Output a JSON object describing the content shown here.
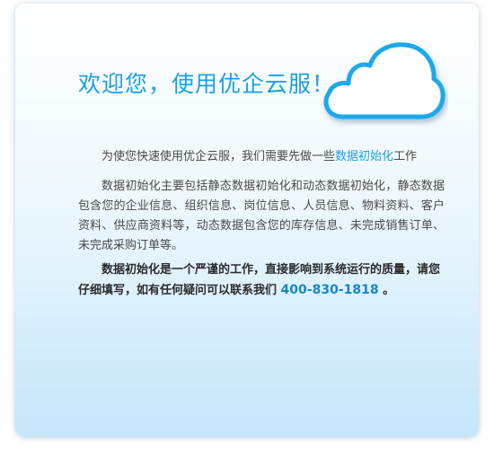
{
  "welcome": {
    "title": "欢迎您，使用优企云服！",
    "icon": "cloud-icon"
  },
  "intro": {
    "text_before": "为使您快速使用优企云服，我们需要先做一些",
    "link_text": "数据初始化",
    "text_after": "工作"
  },
  "description": "数据初始化主要包括静态数据初始化和动态数据初始化，静态数据包含您的企业信息、组织信息、岗位信息、人员信息、物料资料、客户资料、供应商资料等，动态数据包含您的库存信息、未完成销售订单、未完成采购订单等。",
  "notice": {
    "text": "数据初始化是一个严谨的工作，直接影响到系统运行的质量，请您仔细填写，如有任何疑问可以联系我们",
    "phone": "400-830-1818",
    "end": "。"
  },
  "colors": {
    "accent": "#1aa0e6",
    "phone": "#1587c8",
    "body_text": "#4a4a4a",
    "panel_bottom": "#c6e6fb"
  }
}
